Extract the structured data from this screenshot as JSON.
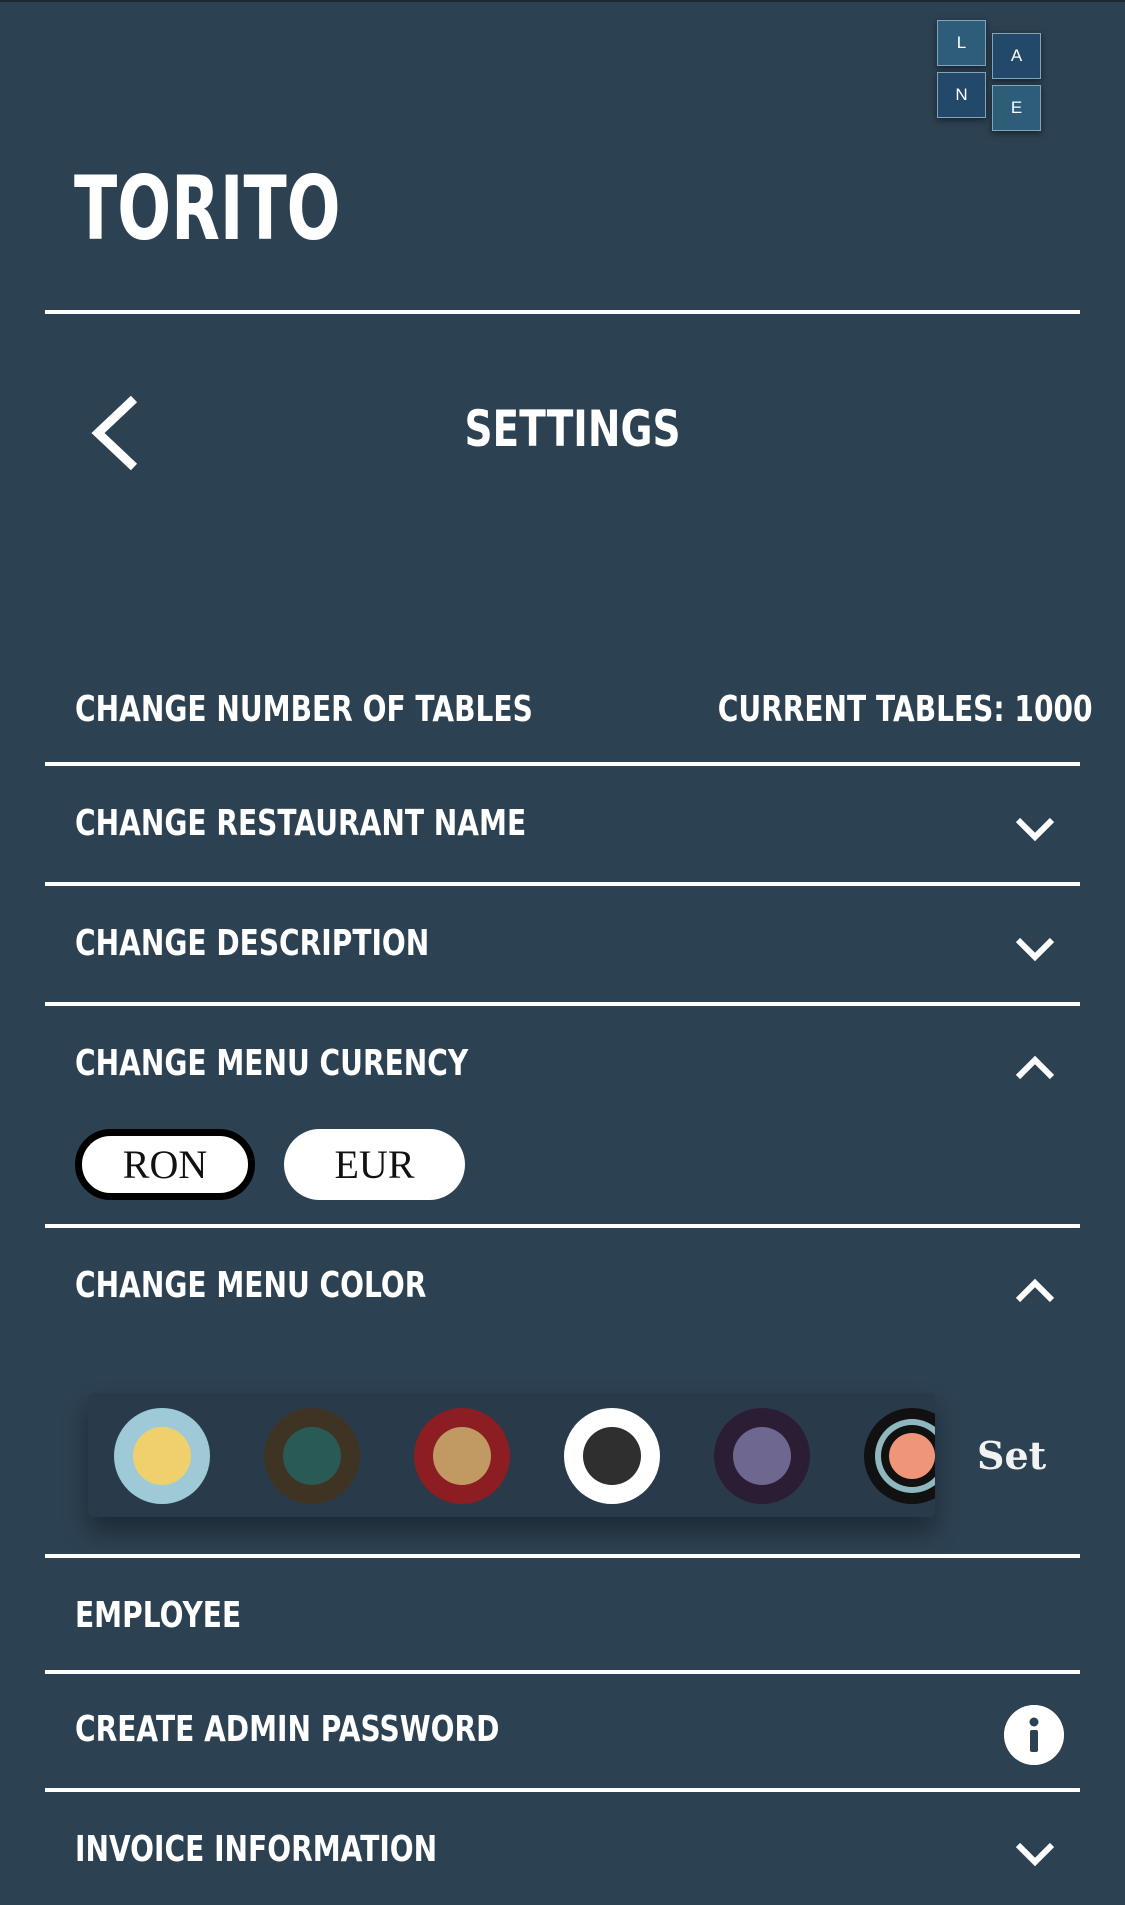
{
  "logo": {
    "letters": [
      "L",
      "A",
      "N",
      "E"
    ]
  },
  "brand": {
    "name": "TORITO"
  },
  "header": {
    "title": "SETTINGS",
    "back_icon": "chevron-left-icon"
  },
  "settings": {
    "tables": {
      "label": "CHANGE NUMBER OF TABLES",
      "current": "CURRENT TABLES: 1000"
    },
    "restaurant_name": {
      "label": "CHANGE RESTAURANT NAME",
      "icon": "chevron-down-icon"
    },
    "description": {
      "label": "CHANGE DESCRIPTION",
      "icon": "chevron-down-icon"
    },
    "currency": {
      "label": "CHANGE MENU CURENCY",
      "icon": "chevron-up-icon",
      "options": [
        "RON",
        "EUR"
      ],
      "selected": "RON"
    },
    "menu_color": {
      "label": "CHANGE MENU COLOR",
      "icon": "chevron-up-icon",
      "swatches": [
        {
          "outer": "#9ecad8",
          "inner": "#f0d06c"
        },
        {
          "outer": "#3f3424",
          "inner": "#2a5a56"
        },
        {
          "outer": "#8c1d22",
          "inner": "#c09a62"
        },
        {
          "outer": "#ffffff",
          "inner": "#2f2f2f"
        },
        {
          "outer": "#2b1d34",
          "inner": "#6e6790"
        },
        {
          "outer": "#111111",
          "inner": "#ef967a",
          "ring": "#8fb7c0"
        }
      ],
      "set_label": "Set"
    },
    "employee": {
      "label": "EMPLOYEE"
    },
    "admin_password": {
      "label": "CREATE ADMIN PASSWORD",
      "icon": "info-icon"
    },
    "invoice": {
      "label": "INVOICE INFORMATION",
      "icon": "chevron-down-icon"
    }
  },
  "colors": {
    "background": "#2c4152",
    "accent": "#ffffff"
  }
}
